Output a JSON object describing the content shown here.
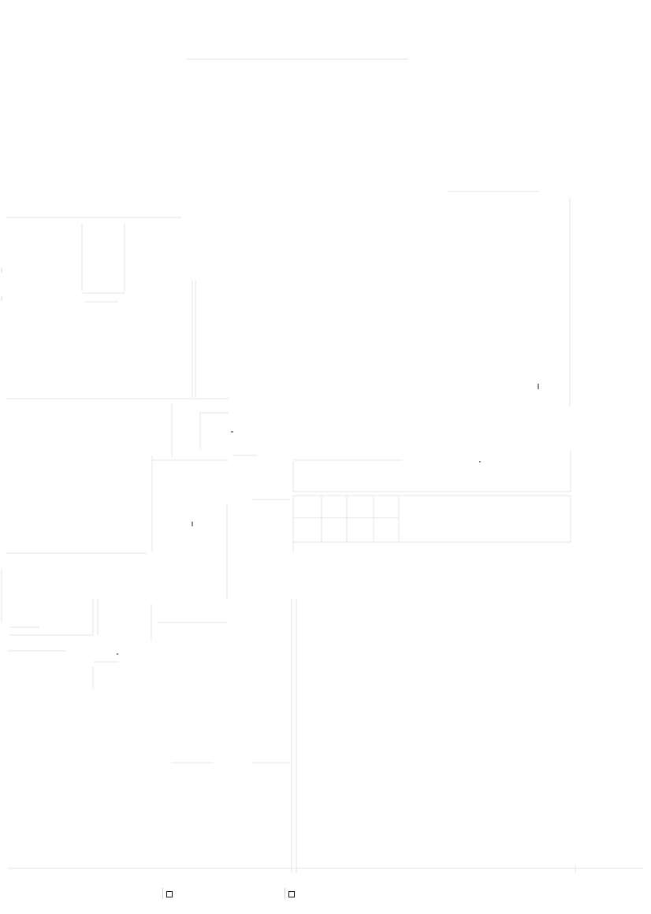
{
  "page": {
    "background_color": "#ffffff",
    "line_color": "#e6e6e6",
    "accent_color": "#111111"
  },
  "diagram": {
    "texts": [],
    "markers": [
      "square-marker-left",
      "square-marker-right"
    ]
  }
}
